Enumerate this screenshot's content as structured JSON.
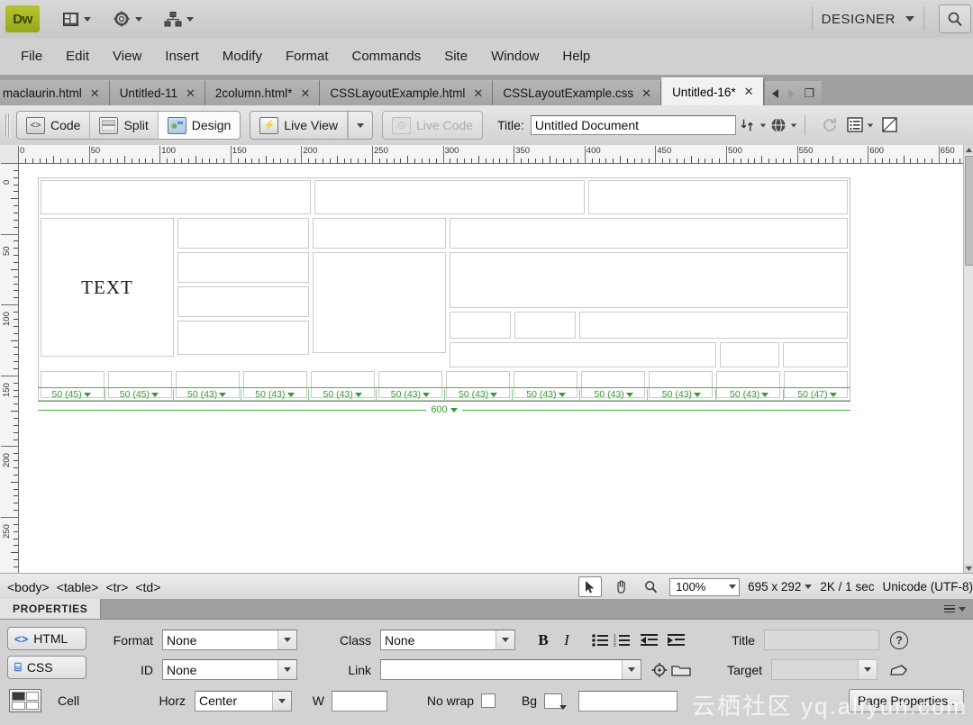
{
  "appbar": {
    "logo": "Dw",
    "icons": [
      "layout-switcher-icon",
      "gear-icon",
      "site-manager-icon"
    ],
    "workspace_label": "DESIGNER",
    "search_icon": "search-icon"
  },
  "menubar": {
    "items": [
      "File",
      "Edit",
      "View",
      "Insert",
      "Modify",
      "Format",
      "Commands",
      "Site",
      "Window",
      "Help"
    ]
  },
  "tabs": {
    "items": [
      {
        "label": "maclaurin.html",
        "close": "✕",
        "active": false
      },
      {
        "label": "Untitled-11",
        "close": "✕",
        "active": false
      },
      {
        "label": "2column.html*",
        "close": "✕",
        "active": false
      },
      {
        "label": "CSSLayoutExample.html",
        "close": "✕",
        "active": false
      },
      {
        "label": "CSSLayoutExample.css",
        "close": "✕",
        "active": false
      },
      {
        "label": "Untitled-16*",
        "close": "✕",
        "active": true
      }
    ],
    "nav": {
      "prev": "prev-tab-arrow",
      "next": "next-tab-arrow",
      "restore": "❐"
    }
  },
  "viewbar": {
    "code_label": "Code",
    "split_label": "Split",
    "design_label": "Design",
    "live_view_label": "Live View",
    "live_code_label": "Live Code",
    "title_label": "Title:",
    "title_value": "Untitled Document",
    "title_placeholder": "Untitled Document",
    "icons": [
      "file-management-icon",
      "preview-browser-icon",
      "refresh-icon",
      "view-options-icon",
      "visual-aids-icon"
    ]
  },
  "ruler": {
    "horizontal_labels": [
      "0",
      "50",
      "100",
      "150",
      "200",
      "250",
      "300",
      "350",
      "400",
      "450",
      "500",
      "550",
      "600",
      "650"
    ],
    "vertical_labels": [
      "0",
      "50",
      "100",
      "150",
      "200",
      "250"
    ],
    "unit": "pixels",
    "major_step": 50
  },
  "canvas": {
    "text_cell": "TEXT",
    "column_markers": [
      "50 (45)",
      "50 (45)",
      "50 (43)",
      "50 (43)",
      "50 (43)",
      "50 (43)",
      "50 (43)",
      "50 (43)",
      "50 (43)",
      "50 (43)",
      "50 (43)",
      "50 (47)"
    ],
    "table_total_width": "600"
  },
  "statusbar": {
    "tag_selector": [
      "<body>",
      "<table>",
      "<tr>",
      "<td>"
    ],
    "tools": [
      "select-tool-icon",
      "hand-tool-icon",
      "zoom-tool-icon"
    ],
    "zoom_level": "100%",
    "window_size": "695 x 292",
    "download_size": "2K / 1 sec",
    "encoding": "Unicode (UTF-8)"
  },
  "properties": {
    "panel_title": "PROPERTIES",
    "html_button": "HTML",
    "css_button": "CSS",
    "format_label": "Format",
    "format_value": "None",
    "id_label": "ID",
    "id_value": "None",
    "class_label": "Class",
    "class_value": "None",
    "link_label": "Link",
    "link_value": "",
    "bold_label": "B",
    "italic_label": "I",
    "title_label": "Title",
    "title_value": "",
    "target_label": "Target",
    "target_value": "",
    "cell_label": "Cell",
    "horz_label": "Horz",
    "horz_value": "Center",
    "w_label": "W",
    "w_value": "",
    "nowrap_label": "No wrap",
    "bg_label": "Bg",
    "page_properties_button": "Page Properties..",
    "icons": [
      "unordered-list-icon",
      "ordered-list-icon",
      "outdent-icon",
      "indent-icon",
      "point-to-file-icon",
      "browse-folder-icon",
      "help-icon",
      "edit-rule-icon"
    ]
  },
  "watermark": "云栖社区 yq.aliyun.com",
  "colors": {
    "logo_green": "#a8bb26",
    "guide_green": "#2f9e2f",
    "panel_gray": "#d2d2d2",
    "tabbar_gray": "#9f9f9f"
  }
}
